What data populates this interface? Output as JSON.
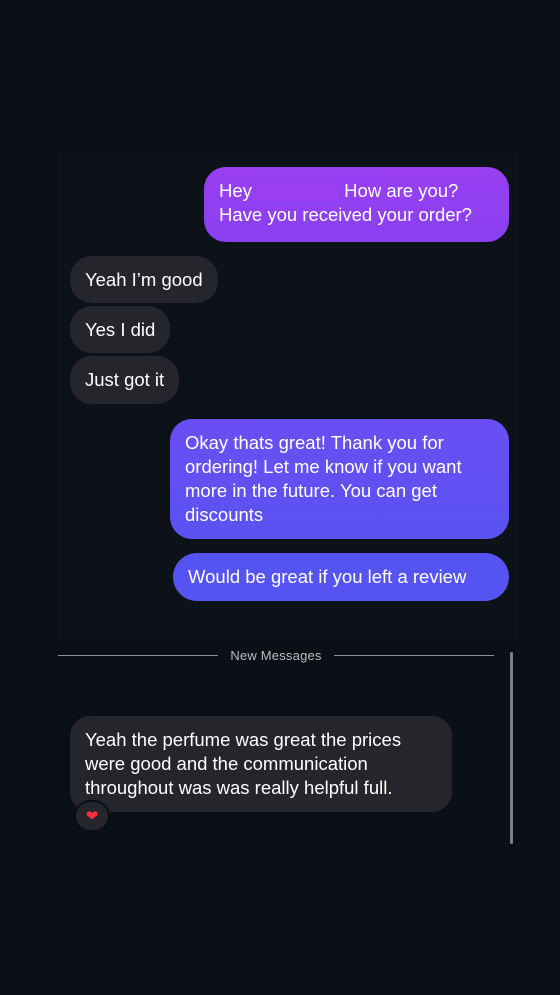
{
  "conversation": {
    "messages": [
      {
        "direction": "outgoing",
        "text_before_name": "Hey ",
        "text_after_name": " How are you?\nHave you received your order?"
      },
      {
        "direction": "incoming",
        "text": "Yeah I’m good"
      },
      {
        "direction": "incoming",
        "text": "Yes I did"
      },
      {
        "direction": "incoming",
        "text": "Just got it"
      },
      {
        "direction": "outgoing",
        "text": "Okay thats great! Thank you for\nordering! Let me know if you want\nmore in the future. You can get\ndiscounts"
      },
      {
        "direction": "outgoing",
        "text": "Would be great if you left a review"
      },
      {
        "direction": "incoming",
        "text": "Yeah the perfume was great the prices\nwere good and the communication\nthroughout was was really helpful full."
      }
    ],
    "new_messages_label": "New Messages",
    "reaction": {
      "emoji": "❤",
      "icon": "red-heart-icon",
      "color": "#ff2d3a"
    }
  },
  "colors": {
    "background": "#0b1016",
    "incoming_bubble": "#24262b",
    "outgoing_purple": "#9a3ff2",
    "outgoing_blue": "#5554f2"
  }
}
